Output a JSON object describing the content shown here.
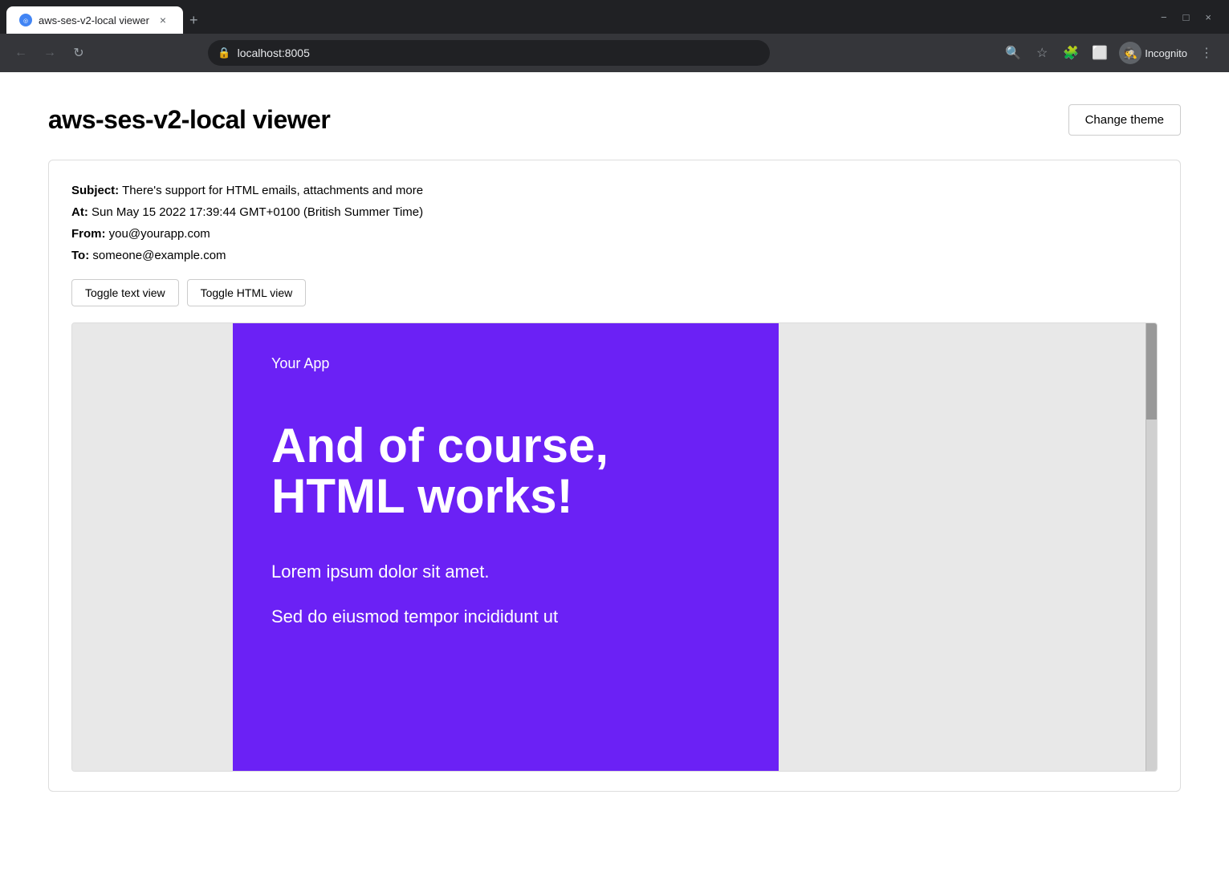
{
  "browser": {
    "tab_title": "aws-ses-v2-local viewer",
    "tab_close": "×",
    "tab_new": "+",
    "window_controls": [
      "∨",
      "−",
      "□",
      "×"
    ],
    "address": "localhost:8005",
    "incognito_label": "Incognito",
    "nav_back": "←",
    "nav_forward": "→",
    "nav_refresh": "↻"
  },
  "page": {
    "title": "aws-ses-v2-local viewer",
    "change_theme_label": "Change theme"
  },
  "email": {
    "subject_label": "Subject:",
    "subject_value": "There's support for HTML emails, attachments and more",
    "at_label": "At:",
    "at_value": "Sun May 15 2022 17:39:44 GMT+0100 (British Summer Time)",
    "from_label": "From:",
    "from_value": "you@yourapp.com",
    "to_label": "To:",
    "to_value": "someone@example.com",
    "toggle_text_label": "Toggle text view",
    "toggle_html_label": "Toggle HTML view"
  },
  "email_preview": {
    "app_name": "Your App",
    "headline": "And of course, HTML works!",
    "body1": "Lorem ipsum dolor sit amet.",
    "body2": "Sed do eiusmod tempor incididunt ut",
    "bg_color": "#6b21f5"
  }
}
